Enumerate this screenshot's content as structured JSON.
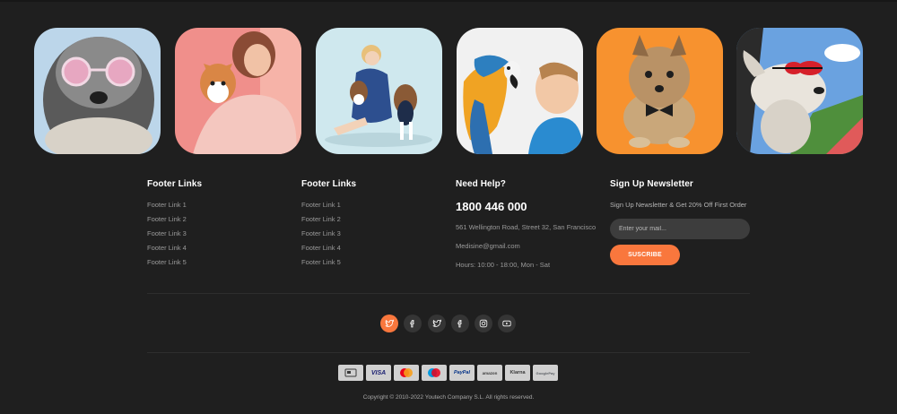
{
  "gallery": [
    {
      "name": "dog-pink-sunglasses",
      "bg": "#bcd6ea"
    },
    {
      "name": "woman-with-corgi",
      "bg": "#f08f8b"
    },
    {
      "name": "girl-with-dogs",
      "bg": "#cfe8ee"
    },
    {
      "name": "parrot-and-boy",
      "bg": "#f1f1f1"
    },
    {
      "name": "yorkie-bowtie",
      "bg": "#f7922f"
    },
    {
      "name": "dog-in-car-goggles",
      "bg": "#6aa2e0"
    }
  ],
  "footer": {
    "col1": {
      "title": "Footer Links",
      "links": [
        "Footer Link 1",
        "Footer Link 2",
        "Footer Link 3",
        "Footer Link 4",
        "Footer Link 5"
      ]
    },
    "col2": {
      "title": "Footer Links",
      "links": [
        "Footer Link 1",
        "Footer Link 2",
        "Footer Link 3",
        "Footer Link 4",
        "Footer Link 5"
      ]
    },
    "help": {
      "title": "Need Help?",
      "phone": "1800 446 000",
      "address": "561 Wellington Road, Street 32, San Francisco",
      "email": "Medisine@gmail.com",
      "hours": "Hours: 10:00 - 18:00, Mon - Sat"
    },
    "newsletter": {
      "title": "Sign Up Newsletter",
      "text": "Sign Up Newsletter & Get 20% Off First Order",
      "placeholder": "Enter your mail...",
      "button": "SUSCRIBE"
    }
  },
  "social": [
    "twitter-icon",
    "facebook-icon",
    "twitter-icon",
    "facebook-icon",
    "instagram-icon",
    "youtube-icon"
  ],
  "payments": [
    "card-icon",
    "VISA",
    "mastercard-icon",
    "maestro-icon",
    "PayPal",
    "amazon",
    "Klarna",
    "GooglePay"
  ],
  "colors": {
    "background": "#1f1f1f",
    "accent": "#f9773d",
    "muted_text": "#9a9a9a",
    "input_bg": "#3d3d3d"
  },
  "copyright": "Copyright ©  2010-2022 Youtech Company S.L. All rights reserved."
}
